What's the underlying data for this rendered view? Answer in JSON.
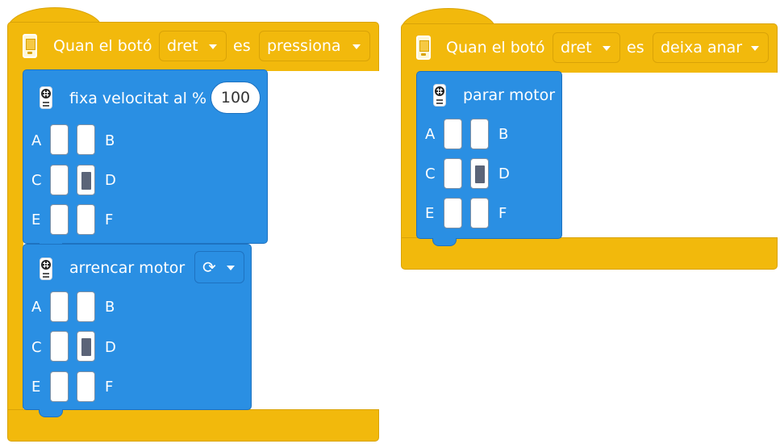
{
  "scripts": [
    {
      "hat": {
        "prefix": "Quan el botó",
        "button_value": "dret",
        "mid": "es",
        "action_value": "pressiona"
      },
      "blocks": [
        {
          "label": "fixa velocitat al %",
          "speed": "100",
          "ports": {
            "A": false,
            "B": false,
            "C": false,
            "D": true,
            "E": false,
            "F": false
          },
          "port_letters": [
            "A",
            "B",
            "C",
            "D",
            "E",
            "F"
          ]
        },
        {
          "label": "arrencar motor",
          "direction_icon": "rotate-clockwise-icon",
          "direction_glyph": "⟳",
          "ports": {
            "A": false,
            "B": false,
            "C": false,
            "D": true,
            "E": false,
            "F": false
          },
          "port_letters": [
            "A",
            "B",
            "C",
            "D",
            "E",
            "F"
          ]
        }
      ]
    },
    {
      "hat": {
        "prefix": "Quan el botó",
        "button_value": "dret",
        "mid": "es",
        "action_value": "deixa anar"
      },
      "blocks": [
        {
          "label": "parar motor",
          "ports": {
            "A": false,
            "B": false,
            "C": false,
            "D": true,
            "E": false,
            "F": false
          },
          "port_letters": [
            "A",
            "B",
            "C",
            "D",
            "E",
            "F"
          ]
        }
      ]
    }
  ],
  "colors": {
    "event_yellow": "#f2b90c",
    "motor_blue": "#2a8fe3",
    "port_active": "#5b6478"
  }
}
